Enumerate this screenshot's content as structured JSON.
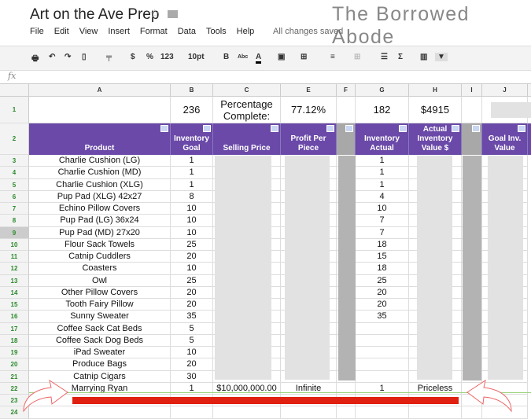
{
  "doc": {
    "title": "Art on the Ave Prep",
    "brand": "The Borrowed Abode",
    "status": "All changes saved"
  },
  "menu": [
    "File",
    "Edit",
    "View",
    "Insert",
    "Format",
    "Data",
    "Tools",
    "Help"
  ],
  "toolbar": {
    "currency": "$",
    "percent": "%",
    "number_format": "123",
    "font_size": "10pt",
    "bold": "B",
    "strike": "Abc",
    "text_color": "A",
    "sigma": "Σ"
  },
  "formula_bar": {
    "label": "fx",
    "value": ""
  },
  "columns": [
    "A",
    "B",
    "C",
    "E",
    "F",
    "G",
    "H",
    "I",
    "J"
  ],
  "row1": {
    "b": "236",
    "c": "Percentage Complete:",
    "e": "77.12%",
    "g": "182",
    "h": "$4915"
  },
  "headers": {
    "a": "Product",
    "b": "Inventory Goal",
    "c": "Selling Price",
    "e": "Profit Per Piece",
    "g": "Inventory Actual",
    "h": "Actual Inventory Value $",
    "j": "Goal Inv. Value"
  },
  "rows": [
    {
      "n": "3",
      "product": "Charlie Cushion (LG)",
      "goal": "1",
      "actual": "1"
    },
    {
      "n": "4",
      "product": "Charlie Cushion (MD)",
      "goal": "1",
      "actual": "1"
    },
    {
      "n": "5",
      "product": "Charlie Cushion (XLG)",
      "goal": "1",
      "actual": "1"
    },
    {
      "n": "6",
      "product": "Pup Pad (XLG) 42x27",
      "goal": "8",
      "actual": "4"
    },
    {
      "n": "7",
      "product": "Echino Pillow Covers",
      "goal": "10",
      "actual": "10"
    },
    {
      "n": "8",
      "product": "Pup Pad (LG) 36x24",
      "goal": "10",
      "actual": "7"
    },
    {
      "n": "9",
      "product": "Pup Pad (MD) 27x20",
      "goal": "10",
      "actual": "7"
    },
    {
      "n": "10",
      "product": "Flour Sack Towels",
      "goal": "25",
      "actual": "18"
    },
    {
      "n": "11",
      "product": "Catnip Cuddlers",
      "goal": "20",
      "actual": "15"
    },
    {
      "n": "12",
      "product": "Coasters",
      "goal": "10",
      "actual": "18"
    },
    {
      "n": "13",
      "product": "Owl",
      "goal": "25",
      "actual": "25"
    },
    {
      "n": "14",
      "product": "Other Pillow Covers",
      "goal": "20",
      "actual": "20"
    },
    {
      "n": "15",
      "product": "Tooth Fairy Pillow",
      "goal": "20",
      "actual": "20"
    },
    {
      "n": "16",
      "product": "Sunny Sweater",
      "goal": "35",
      "actual": "35"
    },
    {
      "n": "17",
      "product": "Coffee Sack Cat Beds",
      "goal": "5",
      "actual": ""
    },
    {
      "n": "18",
      "product": "Coffee Sack Dog Beds",
      "goal": "5",
      "actual": ""
    },
    {
      "n": "19",
      "product": "iPad Sweater",
      "goal": "10",
      "actual": ""
    },
    {
      "n": "20",
      "product": "Produce Bags",
      "goal": "20",
      "actual": ""
    },
    {
      "n": "21",
      "product": "Catnip Cigars",
      "goal": "30",
      "actual": ""
    },
    {
      "n": "22",
      "product": "Marrying Ryan",
      "goal": "1",
      "price": "$10,000,000.00",
      "profit": "Infinite",
      "actual": "1",
      "value": "Priceless"
    },
    {
      "n": "23",
      "product": "",
      "goal": "",
      "actual": ""
    },
    {
      "n": "24",
      "product": "",
      "goal": "",
      "actual": ""
    }
  ],
  "colors": {
    "header": "#6a49a8",
    "highlight": "#e02010",
    "rownum": "#2a8a2a"
  }
}
